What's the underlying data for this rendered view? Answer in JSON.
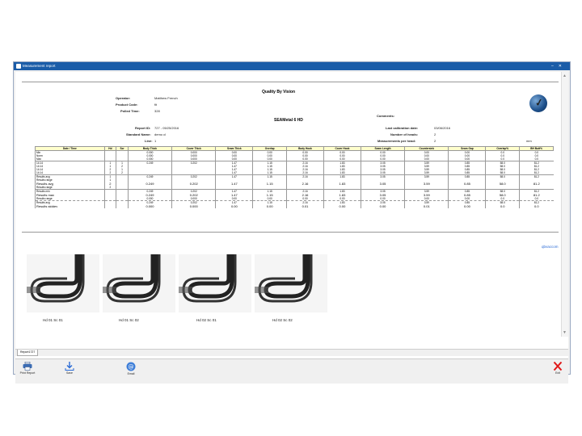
{
  "window": {
    "title": "Measurement report"
  },
  "report": {
    "company": "Quality By Vision",
    "operator_label": "Operator:",
    "operator": "Matthew French",
    "product_label": "Product Code:",
    "product": "fit",
    "polled_label": "Polled Time:",
    "polled": "328",
    "comments_label": "Comments:",
    "machine": "SEAMetal 6 HD",
    "reportid_label": "Report ID:",
    "reportid": "727 - 05/25/2016",
    "standard_label": "Standard Name:",
    "standard": "demo cl",
    "line_label": "Line:",
    "line": "1",
    "lastcal_label": "Last calibration date:",
    "lastcal": "03/06/2016",
    "heads_label": "Number of heads:",
    "heads": "2",
    "meas_label": "Measurements per head:",
    "meas": "2",
    "unit": "mm"
  },
  "table": {
    "headers": [
      "Date / Time",
      "Hd",
      "Scr",
      "Body Thick",
      "Cover Thick",
      "Seam Thick",
      "Overlap",
      "Body Hook",
      "Cover Hook",
      "Seam Length",
      "Countersink",
      "Seam Gap",
      "Overlap%",
      "BH Butt%"
    ],
    "rows": [
      {
        "c": [
          "Min",
          "",
          "",
          "0.000",
          "0.000",
          "0.00",
          "0.00",
          "0.00",
          "0.00",
          "0.00",
          "0.00",
          "0.00",
          "0.0",
          "0.0"
        ],
        "cls": "sep"
      },
      {
        "c": [
          "Norm",
          "",
          "",
          "0.000",
          "0.000",
          "0.00",
          "0.00",
          "0.00",
          "0.00",
          "0.00",
          "0.00",
          "0.00",
          "0.0",
          "0.0"
        ],
        "cls": ""
      },
      {
        "c": [
          "Max",
          "",
          "",
          "0.000",
          "0.000",
          "0.00",
          "0.00",
          "0.00",
          "0.00",
          "0.00",
          "0.00",
          "0.00",
          "0.0",
          "0.0"
        ],
        "cls": ""
      },
      {
        "c": [
          "14:14",
          "1",
          "1",
          "0.249",
          "0.202",
          "1.47",
          "1.15",
          "2.16",
          "1.83",
          "3.05",
          "3.59",
          "0.85",
          "58.0",
          "81.2"
        ],
        "cls": "sep"
      },
      {
        "c": [
          "14:14",
          "1",
          "2",
          "",
          "",
          "1.47",
          "1.15",
          "2.16",
          "1.83",
          "3.05",
          "3.59",
          "0.85",
          "58.0",
          "81.2"
        ],
        "cls": ""
      },
      {
        "c": [
          "14:14",
          "2",
          "1",
          "",
          "",
          "1.47",
          "1.15",
          "2.16",
          "1.83",
          "3.05",
          "3.59",
          "0.85",
          "58.0",
          "81.2"
        ],
        "cls": ""
      },
      {
        "c": [
          "14:14",
          "2",
          "2",
          "",
          "",
          "1.47",
          "1.15",
          "2.16",
          "1.83",
          "3.05",
          "3.59",
          "0.85",
          "58.0",
          "81.2"
        ],
        "cls": ""
      },
      {
        "c": [
          "Results avg",
          "1",
          "",
          "0.249",
          "0.202",
          "1.47",
          "1.15",
          "2.16",
          "1.83",
          "3.05",
          "3.59",
          "0.85",
          "58.0",
          "81.2"
        ],
        "cls": "sep"
      },
      {
        "c": [
          "Results range",
          "1",
          "",
          "",
          "",
          "",
          "",
          "",
          "",
          "",
          "",
          "",
          "",
          ""
        ],
        "cls": ""
      },
      {
        "c": [
          "Results avg",
          "2",
          "",
          "0.249",
          "0.202",
          "1.47",
          "1.15",
          "2.16",
          "1.83",
          "3.05",
          "3.59",
          "0.85",
          "58.0",
          "81.2"
        ],
        "cls": "big"
      },
      {
        "c": [
          "Results range",
          "2",
          "",
          "",
          "",
          "",
          "",
          "",
          "",
          "",
          "",
          "",
          "",
          ""
        ],
        "cls": ""
      },
      {
        "c": [
          "Results min",
          "",
          "",
          "0.249",
          "0.202",
          "1.47",
          "1.15",
          "2.16",
          "1.83",
          "3.05",
          "3.59",
          "0.85",
          "58.0",
          "81.2"
        ],
        "cls": "sep"
      },
      {
        "c": [
          "Results max",
          "",
          "",
          "0.249",
          "0.202",
          "1.47",
          "1.15",
          "2.16",
          "1.83",
          "3.05",
          "3.59",
          "0.85",
          "58.0",
          "81.2"
        ],
        "cls": "big"
      },
      {
        "c": [
          "Results range",
          "",
          "",
          "0.000",
          "0.000",
          "0.00",
          "0.00",
          "0.00",
          "0.00",
          "0.00",
          "0.00",
          "0.00",
          "0.0",
          "0.0"
        ],
        "cls": ""
      },
      {
        "c": [
          "Results avg",
          "",
          "",
          "0.249",
          "0.202",
          "1.47",
          "1.15",
          "2.16",
          "1.83",
          "3.05",
          "3.59",
          "0.85",
          "58.0",
          "81.2"
        ],
        "cls": "dsep"
      },
      {
        "c": [
          "Results stddev",
          "",
          "",
          "0.000",
          "0.000",
          "0.00",
          "0.00",
          "0.01",
          "0.00",
          "0.00",
          "0.01",
          "0.00",
          "0.0",
          "0.0"
        ],
        "cls": "big"
      }
    ]
  },
  "weblink": "qbvaccom",
  "images": [
    {
      "caption": "Hd 01 Sc 01"
    },
    {
      "caption": "Hd 01 Sc 02"
    },
    {
      "caption": "Hd 02 Sc 01"
    },
    {
      "caption": "Hd 02 Sc 02"
    }
  ],
  "tab": "Report1727",
  "toolbar": {
    "print": "Print Report",
    "save": "Save",
    "email": "Email",
    "exit": "Exit"
  }
}
